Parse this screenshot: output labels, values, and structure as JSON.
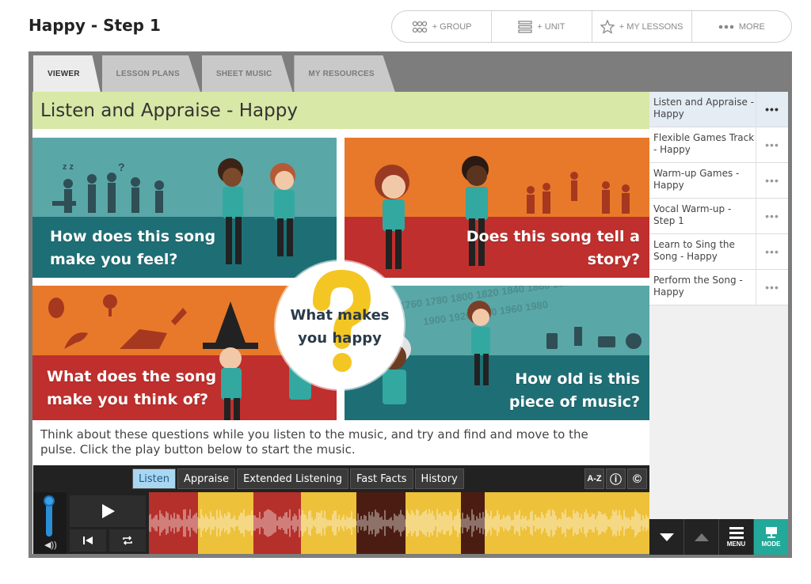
{
  "page": {
    "title": "Happy - Step 1"
  },
  "top_actions": [
    {
      "label": "+ GROUP",
      "icon": "group-icon"
    },
    {
      "label": "+ UNIT",
      "icon": "unit-icon"
    },
    {
      "label": "+ MY LESSONS",
      "icon": "star-icon"
    },
    {
      "label": "MORE",
      "icon": "dots-icon"
    }
  ],
  "tabs": [
    {
      "label": "VIEWER",
      "active": true
    },
    {
      "label": "LESSON PLANS",
      "active": false
    },
    {
      "label": "SHEET MUSIC",
      "active": false
    },
    {
      "label": "MY RESOURCES",
      "active": false
    }
  ],
  "viewer": {
    "title": "Listen and Appraise - Happy",
    "panels": {
      "feel": "How does this song make you feel?",
      "story": "Does this song tell a story?",
      "think": "What does the song make you think of?",
      "old": "How old is this piece of music?"
    },
    "center": "What makes you happy",
    "description": "Think about these questions while you listen to the music, and try and find and move to the pulse. Click the play button below to start the music."
  },
  "player": {
    "tabs": [
      "Listen",
      "Appraise",
      "Extended Listening",
      "Fast Facts",
      "History"
    ],
    "active_tab": "Listen",
    "icons": [
      "a-z-icon",
      "info-icon",
      "copyright-icon"
    ],
    "icon_labels": {
      "az": "A-Z",
      "info": "ⓘ",
      "copyright": "©"
    },
    "segments": [
      {
        "color": "#b5302a"
      },
      {
        "color": "#eec13a"
      },
      {
        "color": "#b5302a"
      },
      {
        "color": "#eec13a"
      },
      {
        "color": "#4b1d12"
      },
      {
        "color": "#eec13a"
      },
      {
        "color": "#4b1d12"
      },
      {
        "color": "#eec13a"
      }
    ]
  },
  "sidebar": {
    "items": [
      {
        "label": "Listen and Appraise - Happy",
        "active": true
      },
      {
        "label": "Flexible Games Track - Happy",
        "active": false
      },
      {
        "label": "Warm-up Games - Happy",
        "active": false
      },
      {
        "label": "Vocal Warm-up - Step 1",
        "active": false
      },
      {
        "label": "Learn to Sing the Song - Happy",
        "active": false
      },
      {
        "label": "Perform the Song - Happy",
        "active": false
      }
    ],
    "controls": {
      "menu": "MENU",
      "mode": "MODE"
    }
  },
  "colors": {
    "teal": "#1e6f75",
    "teal_light": "#5aa7a7",
    "orange": "#e8792a",
    "red": "#bf2f2d",
    "lime": "#d8e8a6",
    "mode": "#22a99a"
  }
}
